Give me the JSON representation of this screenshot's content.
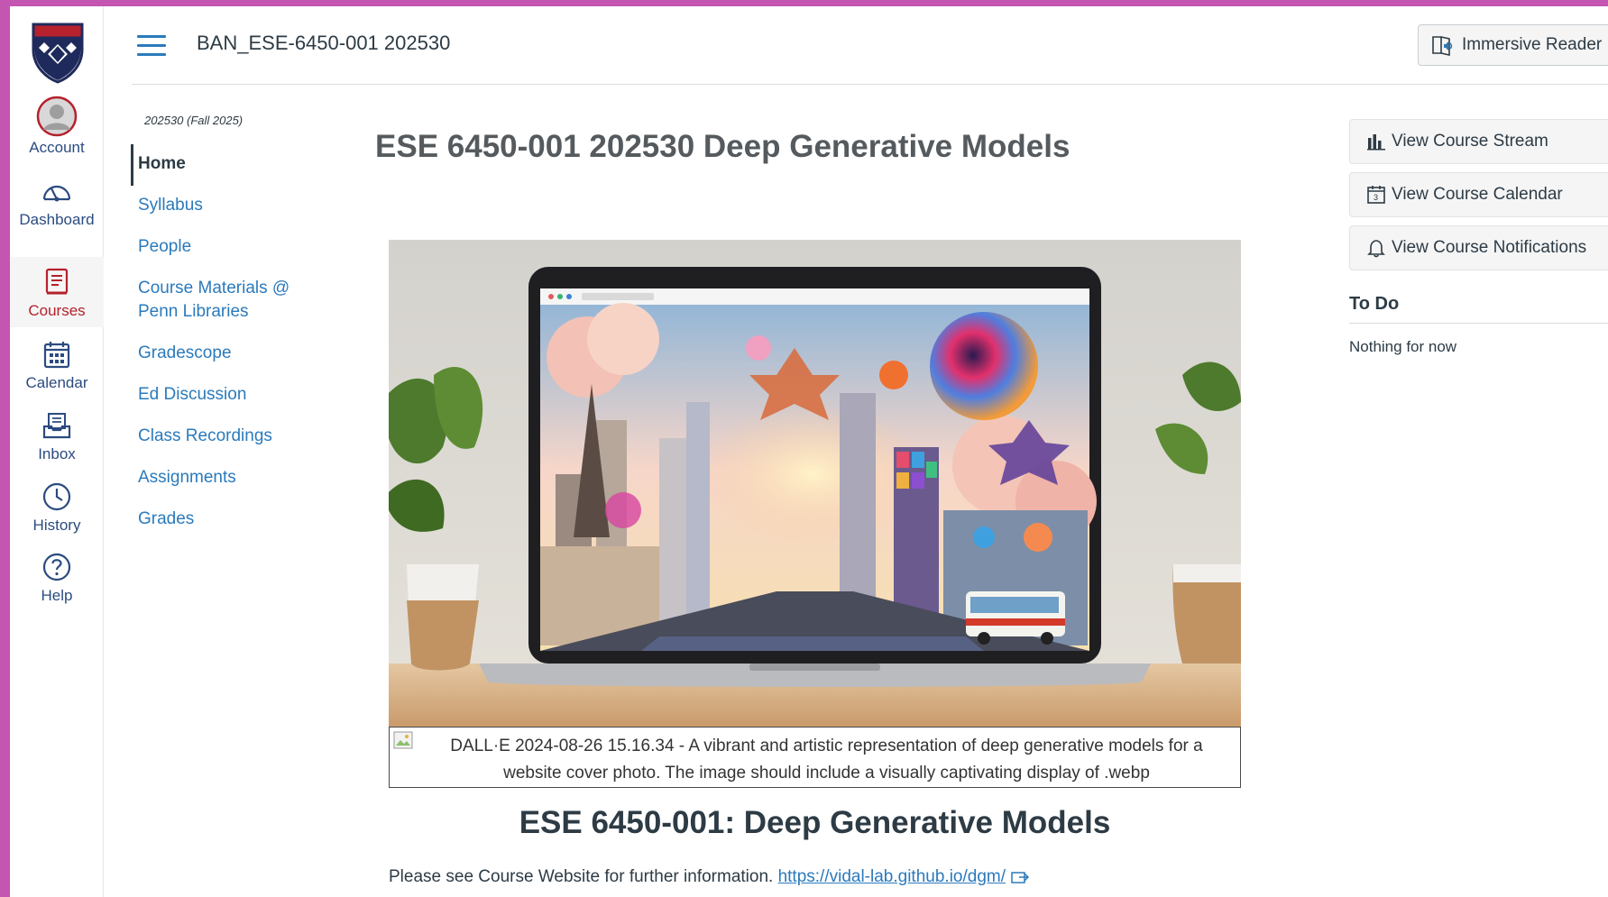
{
  "global_nav": {
    "items": [
      {
        "label": "Account",
        "icon": "avatar"
      },
      {
        "label": "Dashboard",
        "icon": "dashboard-icon"
      },
      {
        "label": "Courses",
        "icon": "courses-icon",
        "active": true
      },
      {
        "label": "Calendar",
        "icon": "calendar-icon"
      },
      {
        "label": "Inbox",
        "icon": "inbox-icon"
      },
      {
        "label": "History",
        "icon": "history-icon"
      },
      {
        "label": "Help",
        "icon": "help-icon"
      }
    ],
    "active_color": "#b5212c",
    "link_color": "#2b4b80"
  },
  "header": {
    "breadcrumb": "BAN_ESE-6450-001 202530",
    "immersive_reader_label": "Immersive Reader"
  },
  "course_nav": {
    "term": "202530 (Fall 2025)",
    "items": [
      {
        "label": "Home",
        "active": true
      },
      {
        "label": "Syllabus"
      },
      {
        "label": "People"
      },
      {
        "label": "Course Materials @",
        "label_line2": "Penn Libraries"
      },
      {
        "label": "Gradescope"
      },
      {
        "label": "Ed Discussion"
      },
      {
        "label": "Class Recordings"
      },
      {
        "label": "Assignments"
      },
      {
        "label": "Grades"
      }
    ]
  },
  "main": {
    "page_title": "ESE 6450-001 202530 Deep Generative Models",
    "image_caption": "DALL·E 2024-08-26 15.16.34 - A vibrant and artistic representation of deep generative models for a website cover photo. The image should include a visually captivating display of .webp",
    "heading": "ESE 6450-001: Deep Generative Models",
    "info_text": "Please see Course Website for further information.",
    "course_link": "https://vidal-lab.github.io/dgm/"
  },
  "right_sidebar": {
    "buttons": [
      {
        "label": "View Course Stream",
        "icon": "bar-chart-icon"
      },
      {
        "label": "View Course Calendar",
        "icon": "calendar-icon"
      },
      {
        "label": "View Course Notifications",
        "icon": "bell-icon"
      }
    ],
    "todo_title": "To Do",
    "todo_empty": "Nothing for now"
  },
  "colors": {
    "frame": "#c455b0",
    "link": "#2b7abc",
    "text": "#2d3b45"
  }
}
